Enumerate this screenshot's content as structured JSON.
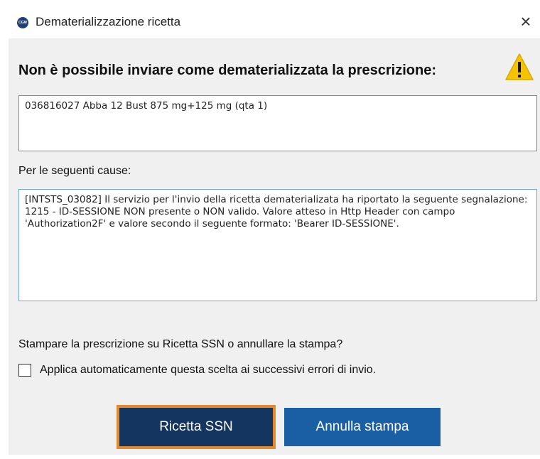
{
  "window": {
    "title": "Dematerializzazione ricetta",
    "close_label": "×",
    "app_icon_text": "CGM"
  },
  "message": {
    "heading": "Non è possibile inviare come dematerializzata la prescrizione:",
    "icon": "warning-icon",
    "prescription_text": "036816027 Abba 12 Bust 875 mg+125 mg (qta 1)",
    "causes_label": "Per le seguenti cause:",
    "causes_text": "[INTSTS_03082] Il servizio per l'invio della ricetta dematerializata ha riportato la seguente segnalazione:\n1215 - ID-SESSIONE NON presente o NON valido. Valore atteso in Http Header con campo 'Authorization2F' e valore secondo il seguente formato: 'Bearer ID-SESSIONE'."
  },
  "prompt": {
    "question": "Stampare la prescrizione su Ricetta SSN o annullare la stampa?",
    "checkbox_label": "Applica automaticamente questa scelta ai successivi errori di invio.",
    "checkbox_checked": false
  },
  "buttons": {
    "primary_label": "Ricetta SSN",
    "secondary_label": "Annulla stampa"
  },
  "colors": {
    "primary_button": "#14355f",
    "primary_highlight": "#e58a2c",
    "secondary_button": "#1a5fa4",
    "warning": "#f5c400"
  }
}
